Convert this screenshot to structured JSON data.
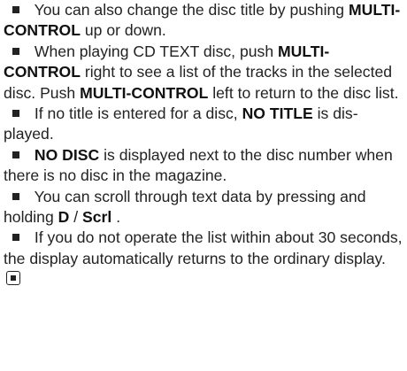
{
  "items": [
    {
      "parts": [
        {
          "text": "You can also change the disc title by pushing ",
          "bold": false
        },
        {
          "text": "MULTI-CONTROL",
          "bold": true
        },
        {
          "text": " up or down.",
          "bold": false
        }
      ]
    },
    {
      "parts": [
        {
          "text": "When playing CD TEXT disc, push ",
          "bold": false
        },
        {
          "text": "MULTI-CONTROL",
          "bold": true
        },
        {
          "text": " right to see a list of the tracks in the selected disc. Push ",
          "bold": false
        },
        {
          "text": "MULTI-CONTROL",
          "bold": true
        },
        {
          "text": " left to return to the disc list.",
          "bold": false
        }
      ]
    },
    {
      "parts": [
        {
          "text": "If no title is entered for a disc, ",
          "bold": false
        },
        {
          "text": "NO TITLE",
          "bold": true
        },
        {
          "text": " is dis-played.",
          "bold": false
        }
      ]
    },
    {
      "parts": [
        {
          "text": "NO DISC",
          "bold": true
        },
        {
          "text": " is displayed next to the disc number when there is no disc in the magazine.",
          "bold": false
        }
      ]
    },
    {
      "parts": [
        {
          "text": "You can scroll through text data by pressing and holding ",
          "bold": false
        },
        {
          "text": "D",
          "bold": true
        },
        {
          "text": "/",
          "bold": false
        },
        {
          "text": "Scrl",
          "bold": true
        },
        {
          "text": ".",
          "bold": false
        }
      ]
    },
    {
      "parts": [
        {
          "text": "If you do not operate the list within about 30 seconds, the display automatically returns to the ordinary display.",
          "bold": false
        }
      ],
      "end_icon": "stop-icon"
    }
  ]
}
